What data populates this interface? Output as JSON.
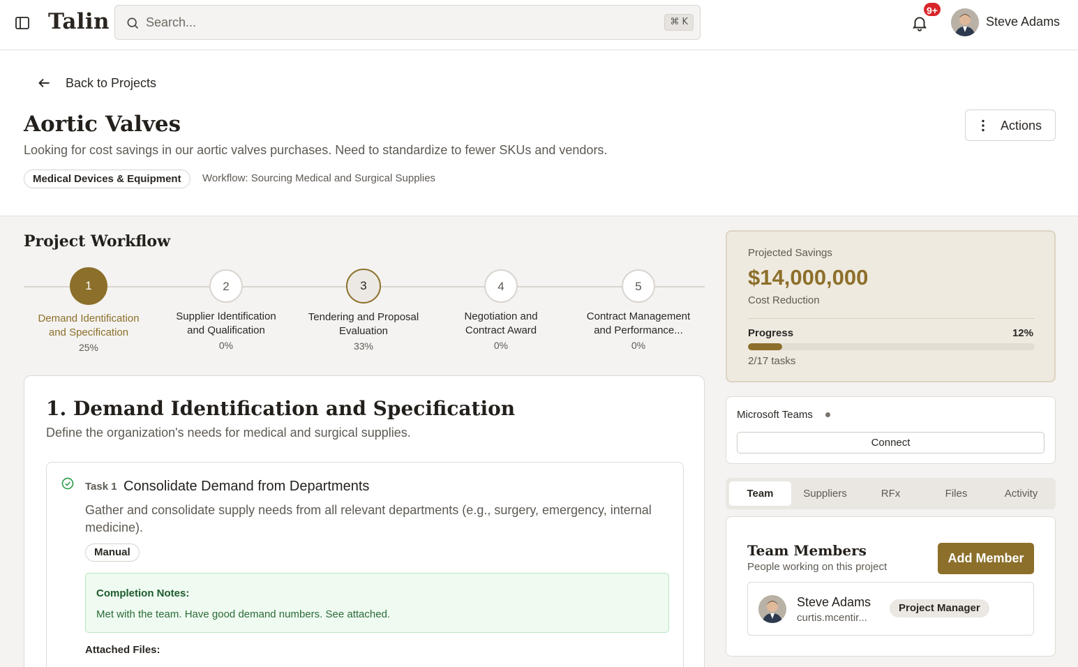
{
  "app": {
    "brand": "Talin",
    "search_placeholder": "Search...",
    "search_shortcut": "⌘ K",
    "notification_count": "9+",
    "user_name": "Steve Adams"
  },
  "header": {
    "back_label": "Back to Projects",
    "project_title": "Aortic Valves",
    "project_description": "Looking for cost savings in our aortic valves purchases. Need to standardize to fewer SKUs and vendors.",
    "category_tag": "Medical Devices & Equipment",
    "workflow_label": "Workflow: Sourcing Medical and Surgical Supplies",
    "actions_label": "Actions"
  },
  "workflow": {
    "title": "Project Workflow",
    "steps": [
      {
        "number": "1",
        "label_line1": "Demand Identification",
        "label_line2": "and Specification",
        "percent": "25%",
        "state": "current"
      },
      {
        "number": "2",
        "label_line1": "Supplier Identification",
        "label_line2": "and Qualification",
        "percent": "0%",
        "state": "pending"
      },
      {
        "number": "3",
        "label_line1": "Tendering and Proposal",
        "label_line2": "Evaluation",
        "percent": "33%",
        "state": "in-progress"
      },
      {
        "number": "4",
        "label_line1": "Negotiation and",
        "label_line2": "Contract Award",
        "percent": "0%",
        "state": "pending"
      },
      {
        "number": "5",
        "label_line1": "Contract Management",
        "label_line2": "and Performance...",
        "percent": "0%",
        "state": "pending"
      }
    ]
  },
  "stage": {
    "title": "1. Demand Identification and Specification",
    "description": "Define the organization's needs for medical and surgical supplies.",
    "task": {
      "number": "Task 1",
      "title": "Consolidate Demand from Departments",
      "description": "Gather and consolidate supply needs from all relevant departments (e.g., surgery, emergency, internal medicine).",
      "type": "Manual",
      "status": "completed",
      "notes_title": "Completion Notes:",
      "notes_body": "Met with the team. Have good demand numbers. See attached.",
      "attached_label": "Attached Files:"
    }
  },
  "savings": {
    "label": "Projected Savings",
    "value": "$14,000,000",
    "type": "Cost Reduction",
    "progress_label": "Progress",
    "progress_percent": "12%",
    "progress_fraction": 0.12,
    "tasks_label": "2/17 tasks"
  },
  "integration": {
    "name": "Microsoft Teams",
    "connect_label": "Connect"
  },
  "tabs": [
    "Team",
    "Suppliers",
    "RFx",
    "Files",
    "Activity"
  ],
  "team": {
    "title": "Team Members",
    "subtitle": "People working on this project",
    "add_label": "Add Member",
    "members": [
      {
        "name": "Steve Adams",
        "email": "curtis.mcentir...",
        "role": "Project Manager"
      }
    ]
  },
  "colors": {
    "accent": "#8c6f2a",
    "success": "#2f9e4e",
    "badge": "#d7262b"
  }
}
